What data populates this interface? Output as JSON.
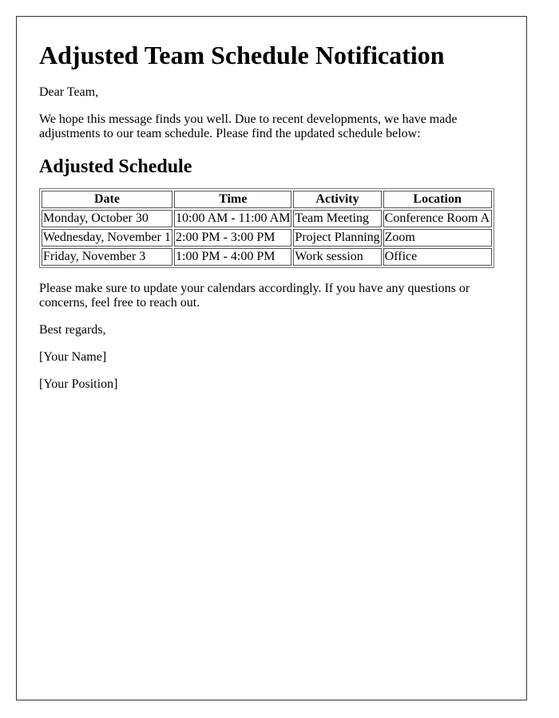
{
  "document": {
    "title": "Adjusted Team Schedule Notification",
    "greeting": "Dear Team,",
    "intro": "We hope this message finds you well. Due to recent developments, we have made adjustments to our team schedule. Please find the updated schedule below:",
    "section_heading": "Adjusted Schedule",
    "table": {
      "headers": [
        "Date",
        "Time",
        "Activity",
        "Location"
      ],
      "rows": [
        [
          "Monday, October 30",
          "10:00 AM - 11:00 AM",
          "Team Meeting",
          "Conference Room A"
        ],
        [
          "Wednesday, November 1",
          "2:00 PM - 3:00 PM",
          "Project Planning",
          "Zoom"
        ],
        [
          "Friday, November 3",
          "1:00 PM - 4:00 PM",
          "Work session",
          "Office"
        ]
      ]
    },
    "closing_note": "Please make sure to update your calendars accordingly. If you have any questions or concerns, feel free to reach out.",
    "sign_off": "Best regards,",
    "signature_name": "[Your Name]",
    "signature_position": "[Your Position]"
  }
}
